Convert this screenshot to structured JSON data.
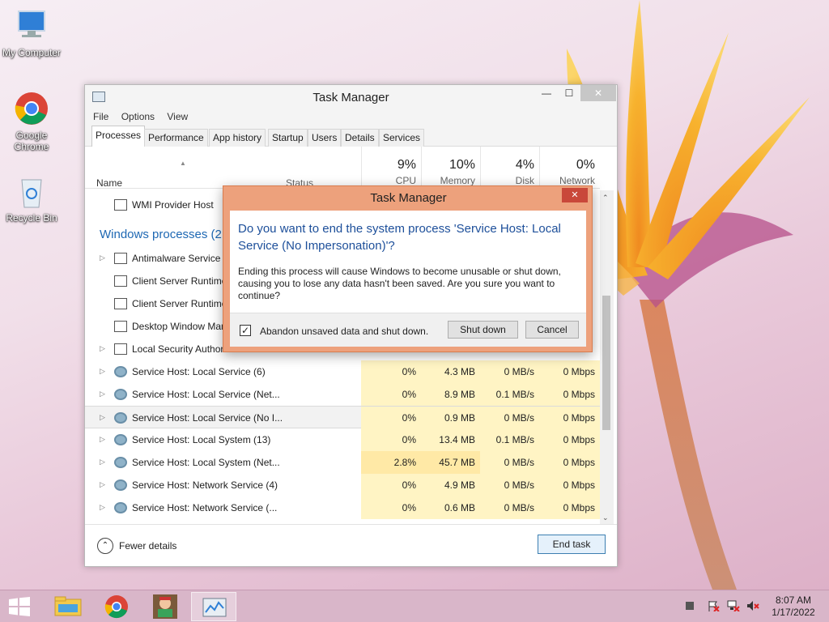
{
  "desktop": {
    "icons": [
      {
        "label": "My Computer"
      },
      {
        "label": "Google Chrome"
      },
      {
        "label": "Recycle Bin"
      }
    ]
  },
  "taskmanager": {
    "title": "Task Manager",
    "menu": [
      "File",
      "Options",
      "View"
    ],
    "tabs": [
      "Processes",
      "Performance",
      "App history",
      "Startup",
      "Users",
      "Details",
      "Services"
    ],
    "columns": {
      "name": "Name",
      "status": "Status",
      "cpu": {
        "pct": "9%",
        "label": "CPU"
      },
      "memory": {
        "pct": "10%",
        "label": "Memory"
      },
      "disk": {
        "pct": "4%",
        "label": "Disk"
      },
      "network": {
        "pct": "0%",
        "label": "Network"
      }
    },
    "top_row": {
      "name": "WMI Provider Host"
    },
    "group_label": "Windows processes (2",
    "partial_rows": [
      {
        "name": "Antimalware Service E"
      },
      {
        "name": "Client Server Runtime"
      },
      {
        "name": "Client Server Runtime"
      },
      {
        "name": "Desktop Window Man"
      },
      {
        "name": "Local Security Authori"
      }
    ],
    "rows": [
      {
        "name": "Service Host: Local Service (6)",
        "cpu": "0%",
        "memory": "4.3 MB",
        "disk": "0 MB/s",
        "network": "0 Mbps"
      },
      {
        "name": "Service Host: Local Service (Net...",
        "cpu": "0%",
        "memory": "8.9 MB",
        "disk": "0.1 MB/s",
        "network": "0 Mbps"
      },
      {
        "name": "Service Host: Local Service (No I...",
        "cpu": "0%",
        "memory": "0.9 MB",
        "disk": "0 MB/s",
        "network": "0 Mbps"
      },
      {
        "name": "Service Host: Local System (13)",
        "cpu": "0%",
        "memory": "13.4 MB",
        "disk": "0.1 MB/s",
        "network": "0 Mbps"
      },
      {
        "name": "Service Host: Local System (Net...",
        "cpu": "2.8%",
        "memory": "45.7 MB",
        "disk": "0 MB/s",
        "network": "0 Mbps"
      },
      {
        "name": "Service Host: Network Service (4)",
        "cpu": "0%",
        "memory": "4.9 MB",
        "disk": "0 MB/s",
        "network": "0 Mbps"
      },
      {
        "name": "Service Host: Network Service (...",
        "cpu": "0%",
        "memory": "0.6 MB",
        "disk": "0 MB/s",
        "network": "0 Mbps"
      }
    ],
    "fewer_details": "Fewer details",
    "end_task": "End task"
  },
  "dialog": {
    "title": "Task Manager",
    "question": "Do you want to end the system process 'Service Host: Local Service (No Impersonation)'?",
    "message": "Ending this process will cause Windows to become unusable or shut down, causing you to lose any data hasn't been saved. Are you sure you want to continue?",
    "checkbox_label": "Abandon unsaved data and shut down.",
    "checkbox_checked": true,
    "shutdown_label": "Shut down",
    "cancel_label": "Cancel"
  },
  "taskbar": {
    "time": "8:07 AM",
    "date": "1/17/2022"
  },
  "colors": {
    "accent_blue": "#1e68b3",
    "dialog_border": "#eda17c",
    "cpu_highlight": "#fff4c4"
  }
}
